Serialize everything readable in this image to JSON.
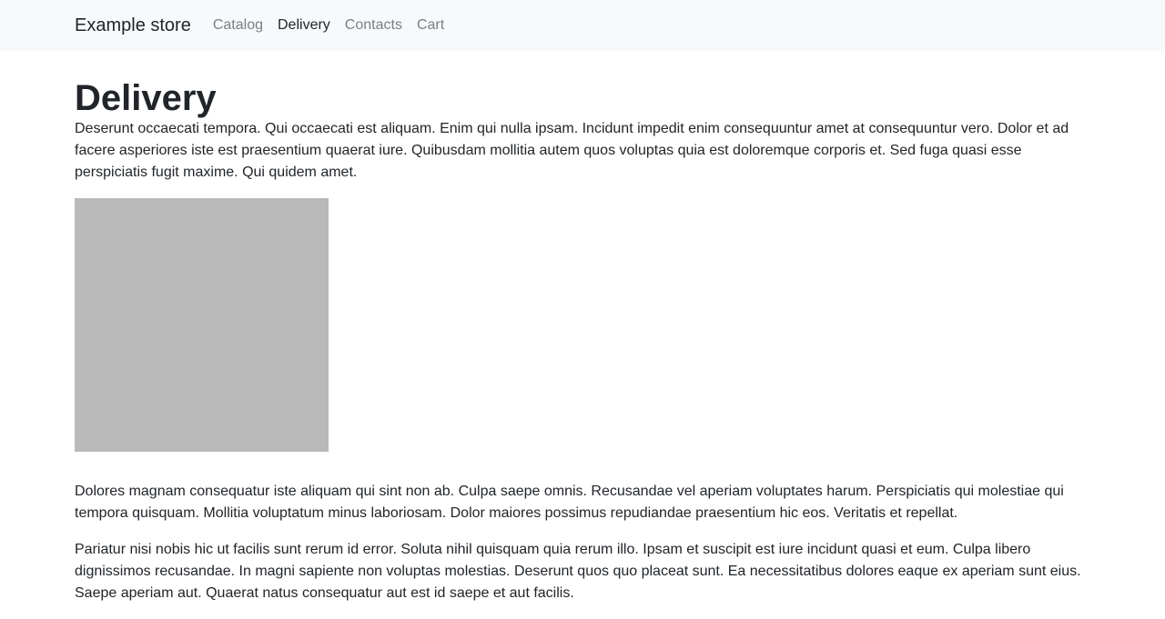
{
  "navbar": {
    "brand": "Example store",
    "links": [
      "Catalog",
      "Delivery",
      "Contacts",
      "Cart"
    ],
    "active": "Delivery"
  },
  "main": {
    "heading": "Delivery",
    "paragraphs": [
      "Deserunt occaecati tempora. Qui occaecati est aliquam. Enim qui nulla ipsam. Incidunt impedit enim consequuntur amet at consequuntur vero. Dolor et ad facere asperiores iste est praesentium quaerat iure. Quibusdam mollitia autem quos voluptas quia est doloremque corporis et. Sed fuga quasi esse perspiciatis fugit maxime. Qui quidem amet.",
      "Dolores magnam consequatur iste aliquam qui sint non ab. Culpa saepe omnis. Recusandae vel aperiam voluptates harum. Perspiciatis qui molestiae qui tempora quisquam. Mollitia voluptatum minus laboriosam. Dolor maiores possimus repudiandae praesentium hic eos. Veritatis et repellat.",
      "Pariatur nisi nobis hic ut facilis sunt rerum id error. Soluta nihil quisquam quia rerum illo. Ipsam et suscipit est iure incidunt quasi et eum. Culpa libero dignissimos recusandae. In magni sapiente non voluptas molestias. Deserunt quos quo placeat sunt. Ea necessitatibus dolores eaque ex aperiam sunt eius. Saepe aperiam aut. Quaerat natus consequatur aut est id saepe et aut facilis."
    ],
    "image_placeholder_color": "#b9b9b9"
  }
}
